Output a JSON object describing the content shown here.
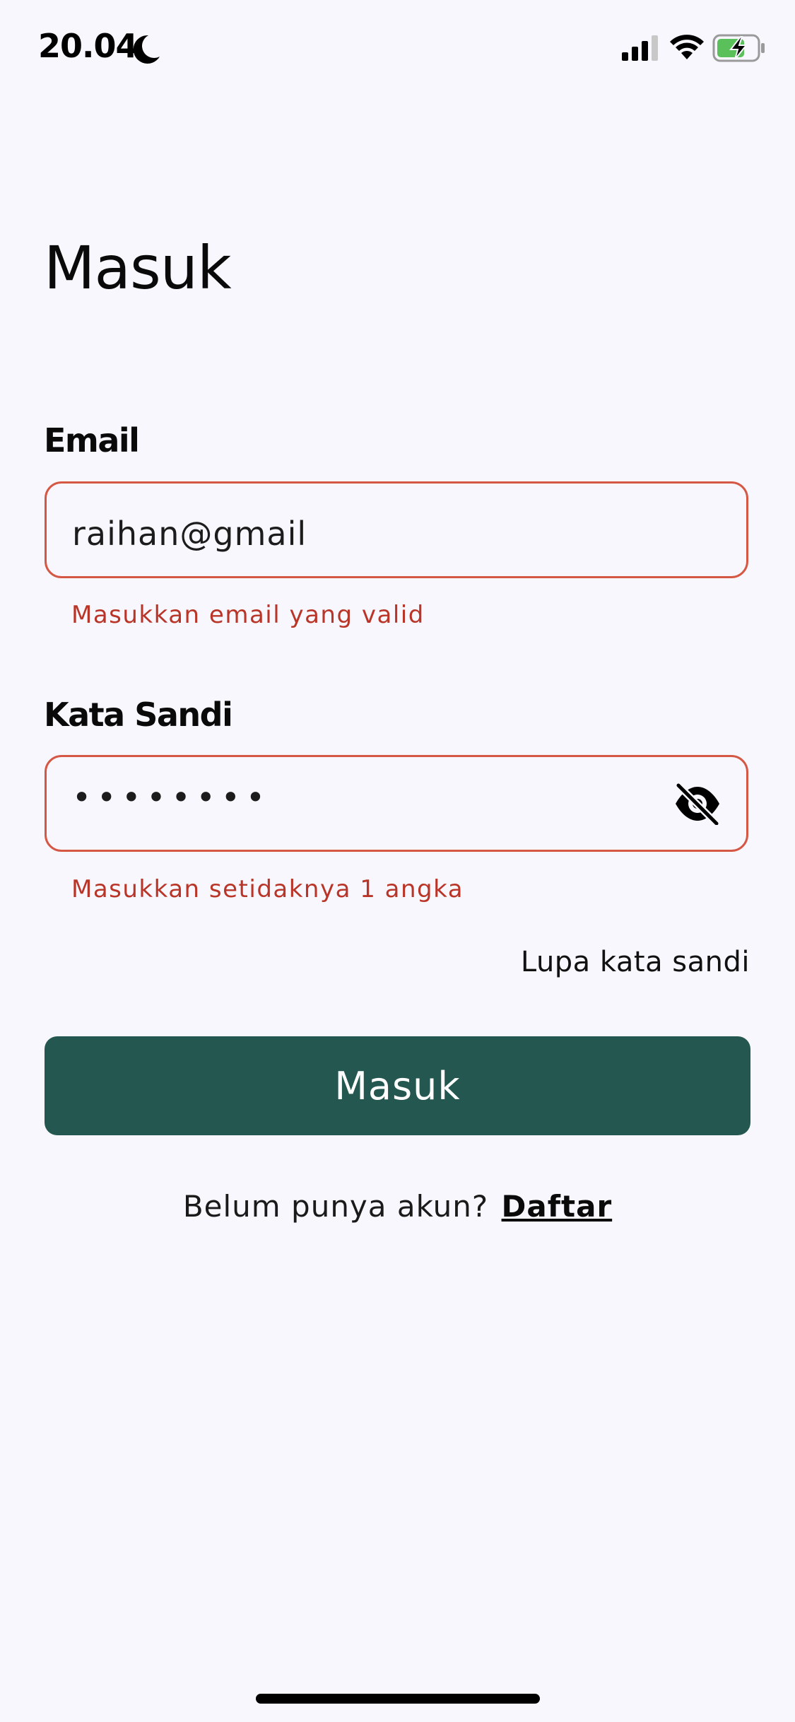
{
  "status_bar": {
    "time": "20.04",
    "icons": [
      "moon-icon",
      "cellular-signal-icon",
      "wifi-icon",
      "battery-charging-icon"
    ],
    "battery_color": "#5ac05a"
  },
  "title": "Masuk",
  "email": {
    "label": "Email",
    "value": "raihan@gmail",
    "error": "Masukkan email yang valid"
  },
  "password": {
    "label": "Kata Sandi",
    "masked_value": "••••••••",
    "toggle_icon": "eye-off-icon",
    "error": "Masukkan setidaknya 1 angka"
  },
  "forgot_password": "Lupa kata sandi",
  "login_button": "Masuk",
  "signup": {
    "prompt": "Belum punya akun?",
    "link": "Daftar"
  },
  "colors": {
    "background": "#f8f7fd",
    "primary": "#235750",
    "error": "#b83528",
    "error_border": "#d55845"
  }
}
